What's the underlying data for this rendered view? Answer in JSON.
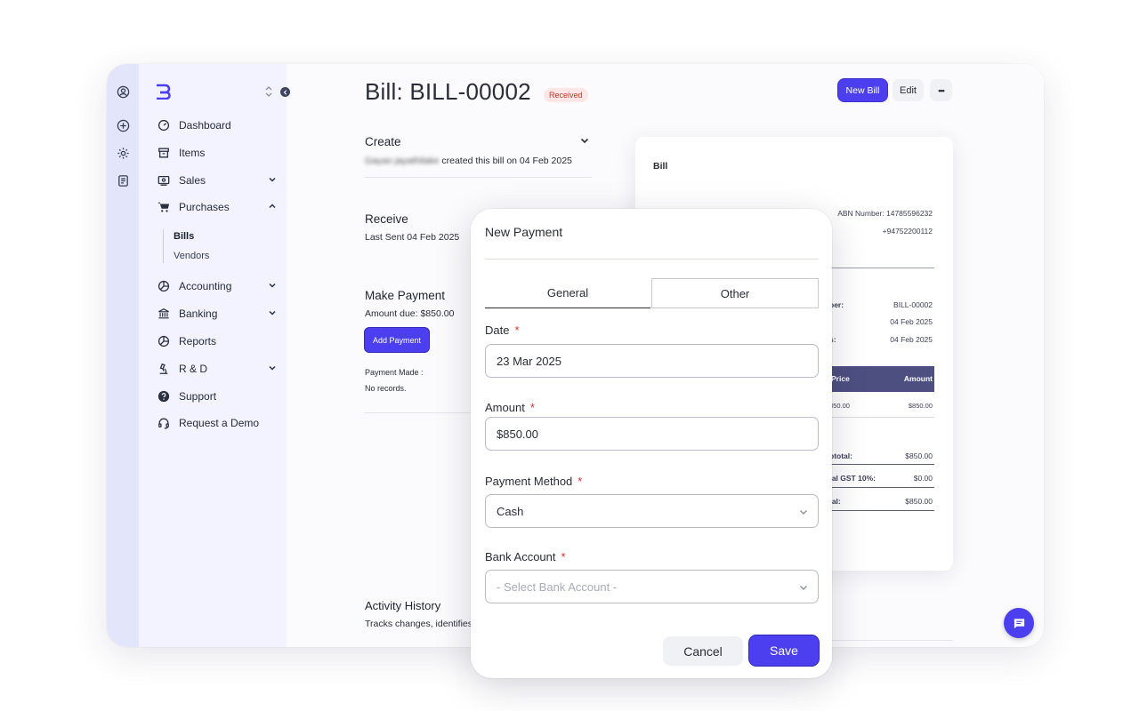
{
  "sidebar": {
    "items": [
      {
        "label": "Dashboard",
        "icon": "dashboard-icon"
      },
      {
        "label": "Items",
        "icon": "archive-icon"
      },
      {
        "label": "Sales",
        "icon": "sales-icon",
        "expandable": true
      },
      {
        "label": "Purchases",
        "icon": "cart-icon",
        "expanded": true
      },
      {
        "label": "Accounting",
        "icon": "accounting-icon",
        "expandable": true
      },
      {
        "label": "Banking",
        "icon": "bank-icon",
        "expandable": true
      },
      {
        "label": "Reports",
        "icon": "reports-icon"
      },
      {
        "label": "R & D",
        "icon": "microscope-icon",
        "expandable": true
      },
      {
        "label": "Support",
        "icon": "help-icon"
      },
      {
        "label": "Request a Demo",
        "icon": "headset-icon"
      }
    ],
    "purchases_sub": [
      {
        "label": "Bills",
        "active": true
      },
      {
        "label": "Vendors",
        "active": false
      }
    ]
  },
  "header": {
    "title": "Bill: BILL-00002",
    "status": "Received",
    "new_bill_label": "New Bill",
    "edit_label": "Edit",
    "more_label": "•••"
  },
  "timeline": {
    "create_title": "Create",
    "create_user": "Gayan jayathilake",
    "create_text": " created this bill on 04 Feb 2025",
    "receive_title": "Receive",
    "receive_text": "Last Sent 04 Feb 2025",
    "payment_title": "Make Payment",
    "amount_due": "Amount due: $850.00",
    "add_payment_label": "Add Payment",
    "payment_made_label": "Payment Made :",
    "no_records": "No records.",
    "activity_title": "Activity History",
    "activity_text": "Tracks changes, identifies"
  },
  "bill_preview": {
    "title": "Bill",
    "abn": "ABN Number: 14785596232",
    "phone": "+94752200112",
    "number_label": "ber:",
    "number_value": "BILL-00002",
    "date1": "04 Feb 2025",
    "date2_label": "s:",
    "date2": "04 Feb 2025",
    "col_price": "Price",
    "col_amount": "Amount",
    "row_price": "850.00",
    "row_amount": "$850.00",
    "subtotal_label": "btotal:",
    "subtotal_value": "$850.00",
    "gst_label": "tal GST 10%:",
    "gst_value": "$0.00",
    "total_label": "tal:",
    "total_value": "$850.00"
  },
  "modal": {
    "title": "New Payment",
    "tabs": [
      "General",
      "Other"
    ],
    "date_label": "Date",
    "date_value": "23 Mar 2025",
    "amount_label": "Amount",
    "amount_value": "$850.00",
    "method_label": "Payment Method",
    "method_value": "Cash",
    "bank_label": "Bank Account",
    "bank_placeholder": "- Select Bank Account -",
    "required_mark": "*",
    "cancel_label": "Cancel",
    "save_label": "Save"
  },
  "colors": {
    "accent": "#4b3ff0",
    "rail": "#e3e6fb",
    "sidebar": "#f2f3fe",
    "table_header": "#4d4f80",
    "badge_bg": "#fde6e6",
    "badge_text": "#c0392b"
  }
}
